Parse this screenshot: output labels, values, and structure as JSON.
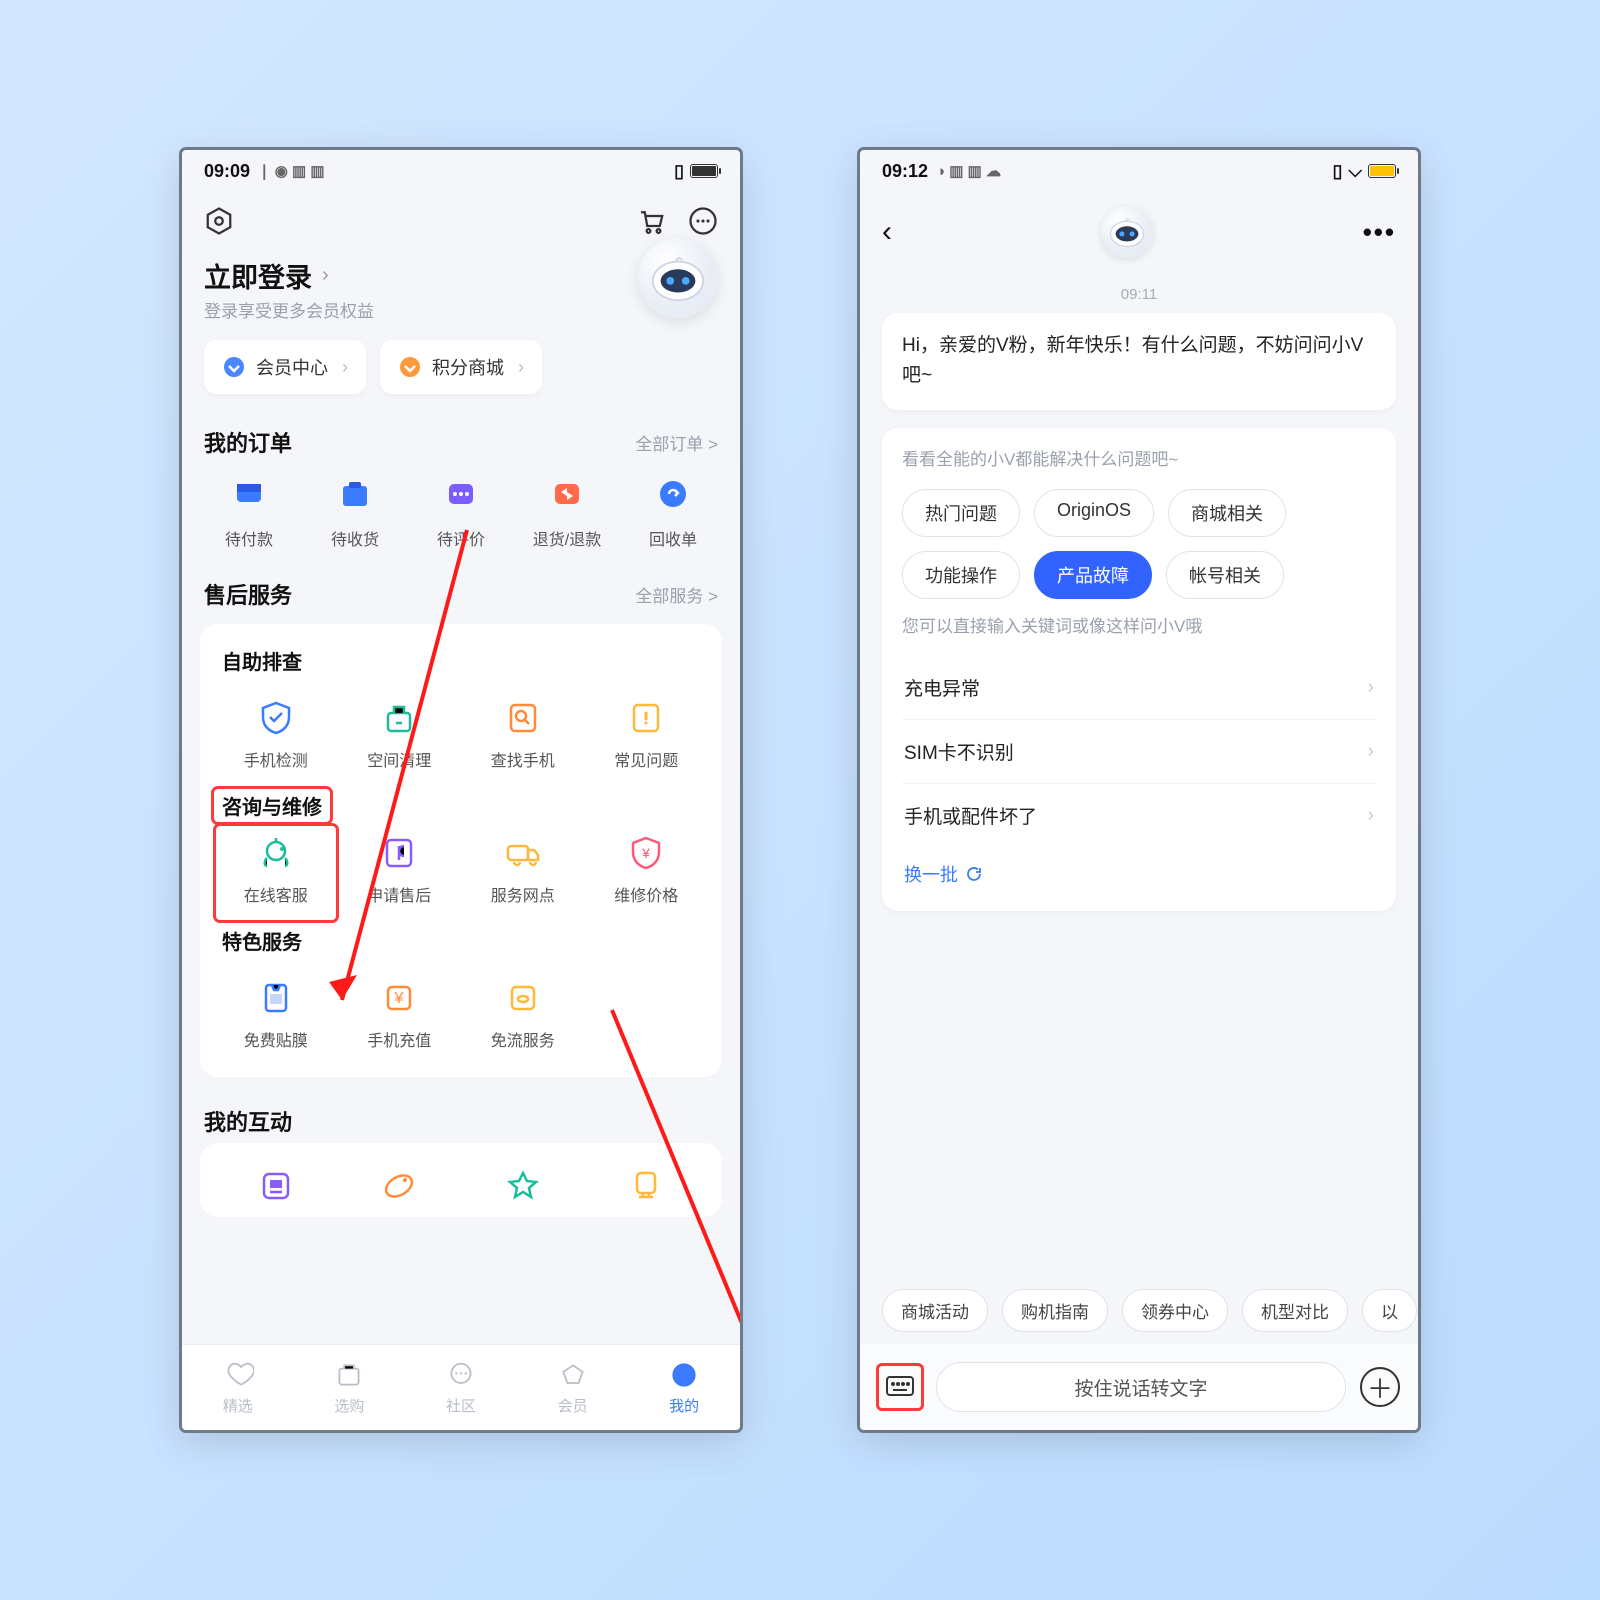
{
  "left": {
    "status": {
      "time": "09:09"
    },
    "login": {
      "title": "立即登录",
      "sub": "登录享受更多会员权益"
    },
    "chips": [
      {
        "label": "会员中心",
        "color": "#4a86ff"
      },
      {
        "label": "积分商城",
        "color": "#ff9a3a"
      }
    ],
    "orders": {
      "title": "我的订单",
      "more": "全部订单 >",
      "items": [
        {
          "label": "待付款",
          "color": "#3b7bff"
        },
        {
          "label": "待收货",
          "color": "#3b7bff"
        },
        {
          "label": "待评价",
          "color": "#7a5cff"
        },
        {
          "label": "退货/退款",
          "color": "#ff6a4a"
        },
        {
          "label": "回收单",
          "color": "#3b7bff"
        }
      ]
    },
    "services": {
      "title": "售后服务",
      "more": "全部服务 >",
      "groups": [
        {
          "title": "自助排查",
          "items": [
            {
              "label": "手机检测",
              "color": "#3b7bff"
            },
            {
              "label": "空间清理",
              "color": "#1abc9c"
            },
            {
              "label": "查找手机",
              "color": "#ff8a3a"
            },
            {
              "label": "常见问题",
              "color": "#ffb83a"
            }
          ]
        },
        {
          "title": "咨询与维修",
          "items": [
            {
              "label": "在线客服",
              "color": "#1abc9c",
              "highlight": true
            },
            {
              "label": "申请售后",
              "color": "#8a5cff"
            },
            {
              "label": "服务网点",
              "color": "#ffb83a"
            },
            {
              "label": "维修价格",
              "color": "#ff5a7a"
            }
          ]
        },
        {
          "title": "特色服务",
          "items": [
            {
              "label": "免费贴膜",
              "color": "#3b7bff"
            },
            {
              "label": "手机充值",
              "color": "#ff8a3a"
            },
            {
              "label": "免流服务",
              "color": "#ffb83a"
            }
          ]
        }
      ]
    },
    "interact": {
      "title": "我的互动",
      "colors": [
        "#8a5cff",
        "#ff8a3a",
        "#1abc9c",
        "#ffb83a"
      ]
    },
    "nav": [
      {
        "label": "精选"
      },
      {
        "label": "选购"
      },
      {
        "label": "社区"
      },
      {
        "label": "会员"
      },
      {
        "label": "我的",
        "active": true
      }
    ]
  },
  "right": {
    "status": {
      "time": "09:12"
    },
    "timestamp": "09:11",
    "greeting": "Hi，亲爱的V粉，新年快乐！有什么问题，不妨问问小V吧~",
    "hint1": "看看全能的小V都能解决什么问题吧~",
    "tags": [
      {
        "label": "热门问题"
      },
      {
        "label": "OriginOS"
      },
      {
        "label": "商城相关"
      },
      {
        "label": "功能操作"
      },
      {
        "label": "产品故障",
        "selected": true
      },
      {
        "label": "帐号相关"
      }
    ],
    "hint2": "您可以直接输入关键词或像这样问小V哦",
    "questions": [
      "充电异常",
      "SIM卡不识别",
      "手机或配件坏了"
    ],
    "refresh": "换一批",
    "suggest": [
      "商城活动",
      "购机指南",
      "领券中心",
      "机型对比",
      "以"
    ],
    "voice": "按住说话转文字"
  }
}
